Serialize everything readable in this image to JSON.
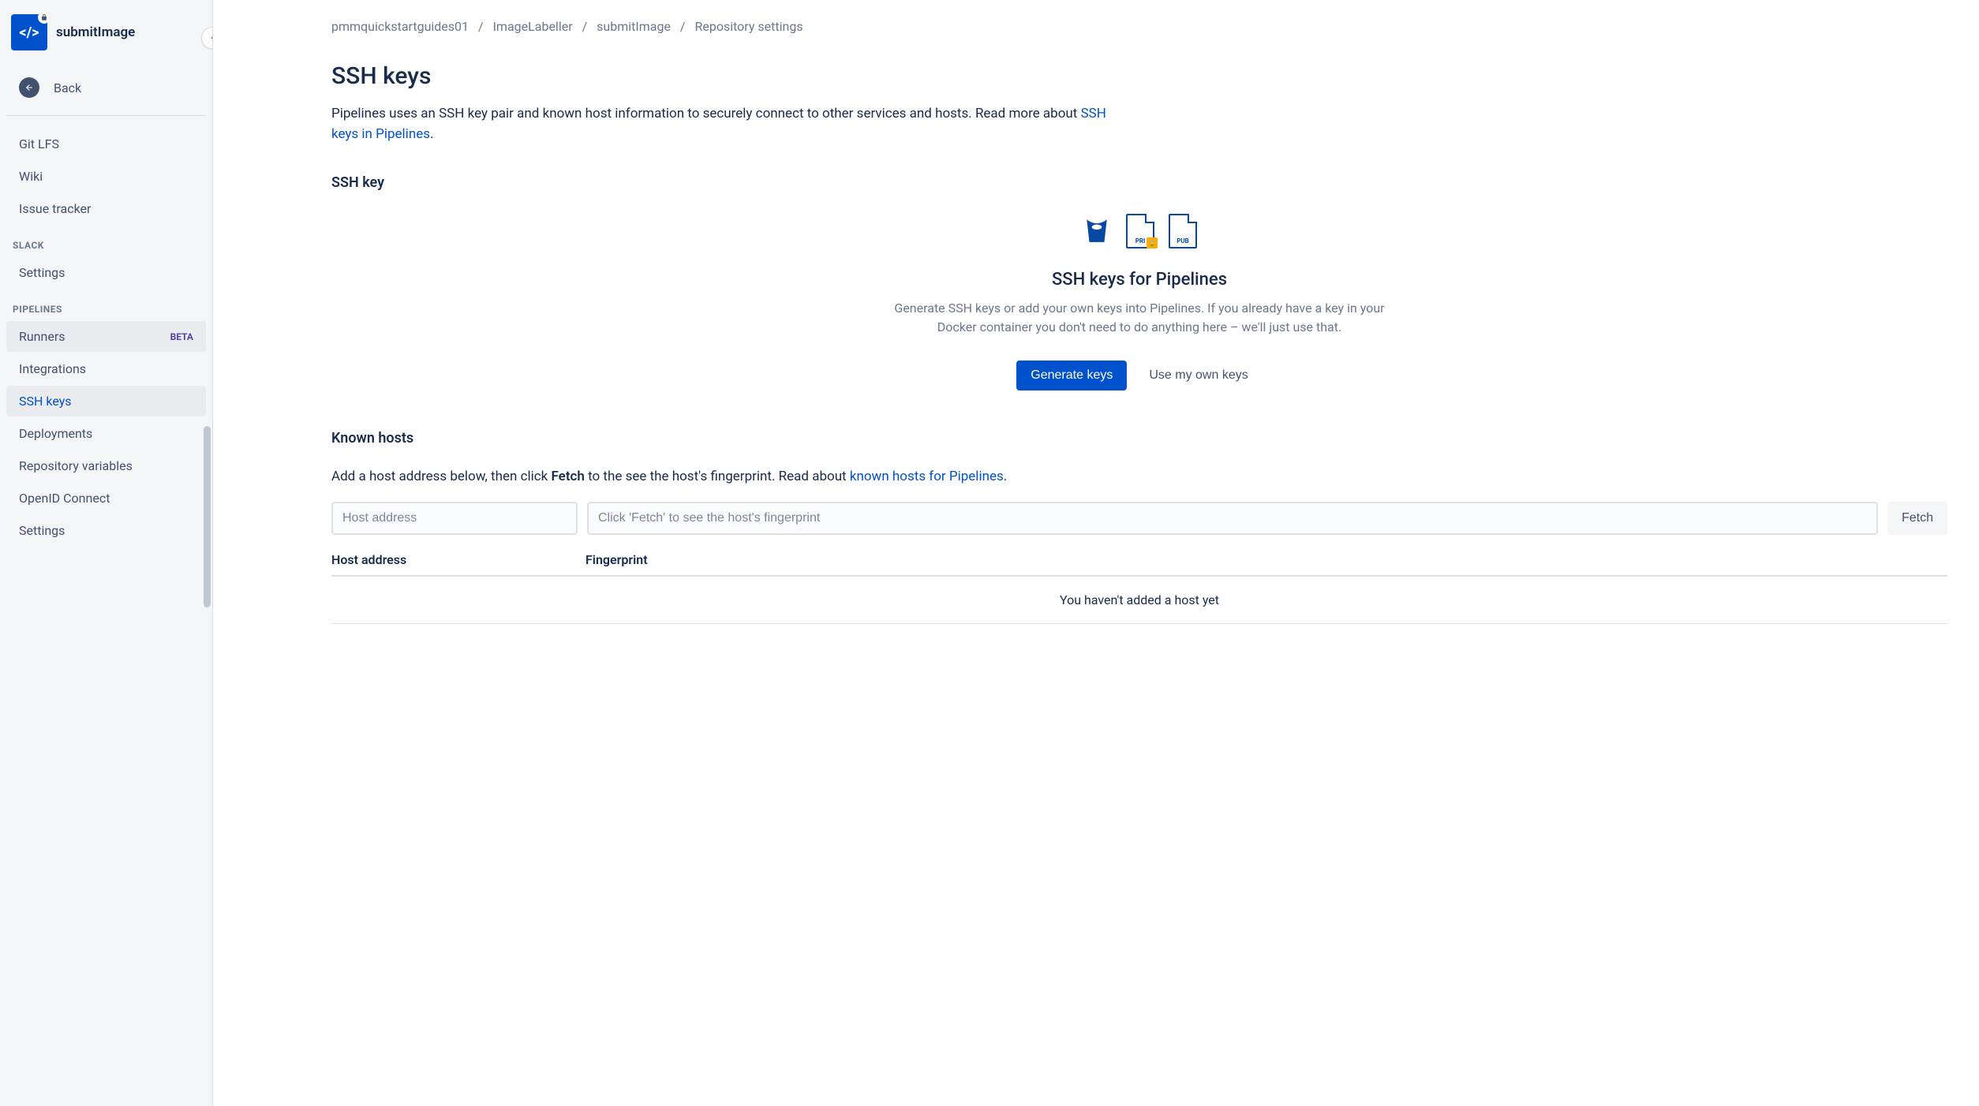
{
  "sidebar": {
    "repoName": "submitImage",
    "backLabel": "Back",
    "items1": [
      {
        "label": "Git LFS"
      },
      {
        "label": "Wiki"
      },
      {
        "label": "Issue tracker"
      }
    ],
    "slackHeading": "SLACK",
    "slackItems": [
      {
        "label": "Settings"
      }
    ],
    "pipelinesHeading": "PIPELINES",
    "pipelinesItems": [
      {
        "label": "Runners",
        "badge": "BETA",
        "hover": true
      },
      {
        "label": "Integrations"
      },
      {
        "label": "SSH keys",
        "active": true
      },
      {
        "label": "Deployments"
      },
      {
        "label": "Repository variables"
      },
      {
        "label": "OpenID Connect"
      },
      {
        "label": "Settings"
      }
    ]
  },
  "breadcrumb": {
    "item1": "pmmquickstartguides01",
    "item2": "ImageLabeller",
    "item3": "submitImage",
    "item4": "Repository settings"
  },
  "page": {
    "title": "SSH keys",
    "introPre": "Pipelines uses an SSH key pair and known host information to securely connect to other services and hosts. Read more about ",
    "introLink": "SSH keys in Pipelines",
    "introPost": ".",
    "sshKeySection": "SSH key",
    "heroTitle": "SSH keys for Pipelines",
    "heroDesc": "Generate SSH keys or add your own keys into Pipelines. If you already have a key in your Docker container you don't need to do anything here – we'll just use that.",
    "btnGenerate": "Generate keys",
    "btnOwn": "Use my own keys",
    "knownHostsTitle": "Known hosts",
    "knownHostsDescPre": "Add a host address below, then click ",
    "knownHostsDescBold": "Fetch",
    "knownHostsDescMid": " to the see the host's fingerprint. Read about ",
    "knownHostsDescLink": "known hosts for Pipelines",
    "knownHostsDescPost": ".",
    "hostPlaceholder": "Host address",
    "fingerprintPlaceholder": "Click 'Fetch' to see the host's fingerprint",
    "btnFetch": "Fetch",
    "colHost": "Host address",
    "colFingerprint": "Fingerprint",
    "emptyHosts": "You haven't added a host yet",
    "docPri": "PRI",
    "docPub": "PUB"
  }
}
